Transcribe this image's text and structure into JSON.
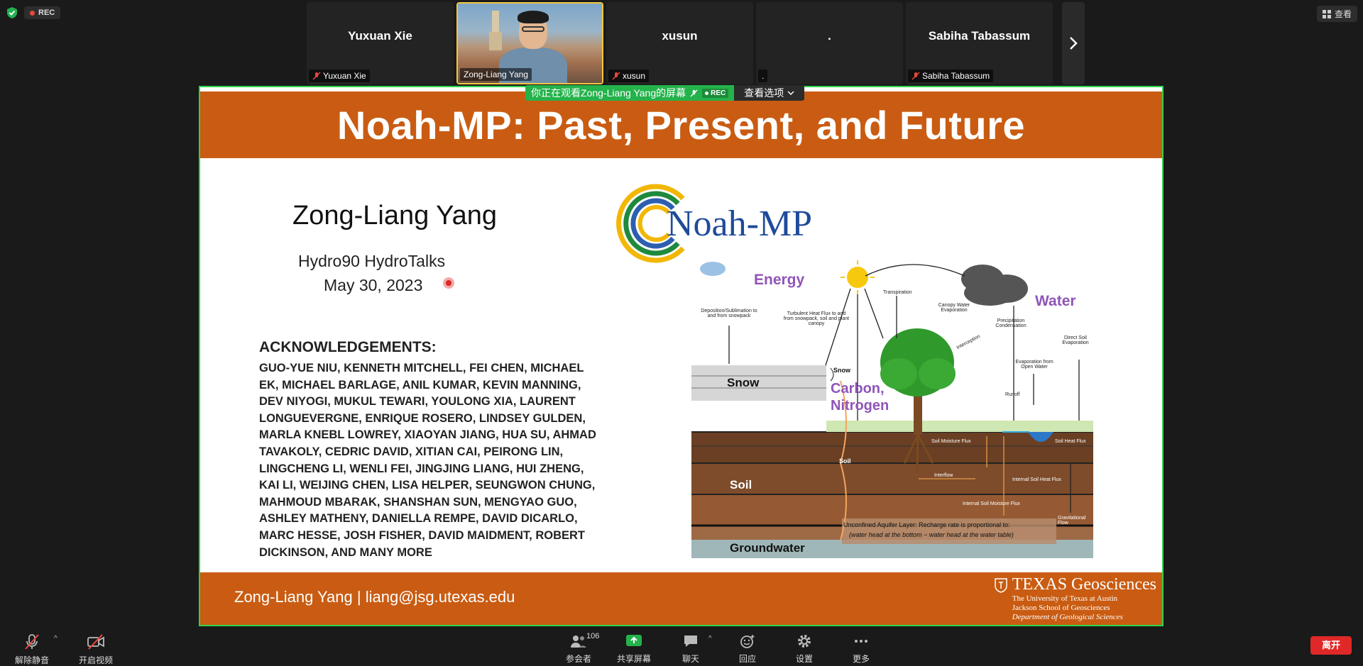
{
  "top_left": {
    "rec_label": "REC"
  },
  "top_right": {
    "view_label": "查看"
  },
  "participants": [
    {
      "name": "Yuxuan Xie",
      "label": "Yuxuan Xie",
      "video": false
    },
    {
      "name": "",
      "label": "Zong-Liang Yang",
      "video": true
    },
    {
      "name": "xusun",
      "label": "xusun",
      "video": false
    },
    {
      "name": ".",
      "label": ".",
      "video": false
    },
    {
      "name": "Sabiha Tabassum",
      "label": "Sabiha Tabassum",
      "video": false
    }
  ],
  "share_banner": {
    "text": "你正在观看Zong-Liang Yang的屏幕",
    "rec": "REC",
    "options": "查看选项"
  },
  "slide": {
    "title": "Noah-MP: Past, Present, and Future",
    "presenter": "Zong-Liang Yang",
    "event": "Hydro90 HydroTalks",
    "date": "May 30, 2023",
    "ack_title": "ACKNOWLEDGEMENTS:",
    "ack_lines": [
      "GUO-YUE NIU, KENNETH MITCHELL, FEI CHEN, MICHAEL",
      "EK, MICHAEL BARLAGE, ANIL KUMAR, KEVIN MANNING,",
      "DEV NIYOGI, MUKUL TEWARI, YOULONG XIA, LAURENT",
      "LONGUEVERGNE, ENRIQUE ROSERO, LINDSEY GULDEN,",
      "MARLA KNEBL LOWREY, XIAOYAN JIANG, HUA SU, AHMAD",
      "TAVAKOLY, CEDRIC DAVID, XITIAN CAI, PEIRONG LIN,",
      "LINGCHENG LI, WENLI FEI, JINGJING LIANG, HUI ZHENG,",
      "KAI LI, WEIJING CHEN, LISA HELPER, SEUNGWON CHUNG,",
      "MAHMOUD MBARAK, SHANSHAN SUN, MENGYAO GUO,",
      "ASHLEY MATHENY, DANIELLA REMPE, DAVID DICARLO,",
      "MARC HESSE, JOSH FISHER, DAVID MAIDMENT, ROBERT",
      "DICKINSON, AND MANY MORE"
    ],
    "logo_text": "Noah-MP",
    "diagram": {
      "energy": "Energy",
      "water": "Water",
      "carbon": "Carbon,",
      "nitrogen": "Nitrogen",
      "snow": "Snow",
      "snow_small": "Snow",
      "soil": "Soil",
      "soil_small": "Soil",
      "groundwater": "Groundwater",
      "deposition": "Deposition/Sublimation to and from snowpack",
      "turbulent": "Turbulent Heat Flux to and from snowpack, soil and plant canopy",
      "transpiration": "Transpiration",
      "canopy_evap": "Canopy Water Evaporation",
      "interception": "Interception",
      "precip": "Precipitation Condensation",
      "direct_soil": "Direct Soil Evaporation",
      "open_water": "Evaporation from Open Water",
      "runoff": "Runoff",
      "soil_moisture": "Soil Moisture Flux",
      "soil_heat": "Soil Heat Flux",
      "interflow": "Interflow",
      "internal_heat": "Internal Soil Heat Flux",
      "internal_moisture": "Internal Soil Moisture Flux",
      "grav": "Gravitational Flow",
      "aquifer1": "Unconfined Aquifer Layer: Recharge rate is proportional to:",
      "aquifer2": "(water head at the bottom − water head at the water table)"
    },
    "footer_name": "Zong-Liang Yang |  liang@jsg.utexas.edu",
    "footer_logo": "TEXAS Geosciences",
    "footer_sub1": "The University of Texas at Austin",
    "footer_sub2": "Jackson School of Geosciences",
    "footer_sub3": "Department of Geological Sciences"
  },
  "toolbar": {
    "mute": "解除静音",
    "video": "开启视频",
    "participants": "参会者",
    "participant_count": "106",
    "share": "共享屏幕",
    "chat": "聊天",
    "react": "回应",
    "settings": "设置",
    "more": "更多",
    "leave": "离开"
  },
  "colors": {
    "slide_orange": "#c95c12",
    "share_border": "#2fd34b",
    "leave_red": "#e02828",
    "share_green": "#24b24b"
  }
}
